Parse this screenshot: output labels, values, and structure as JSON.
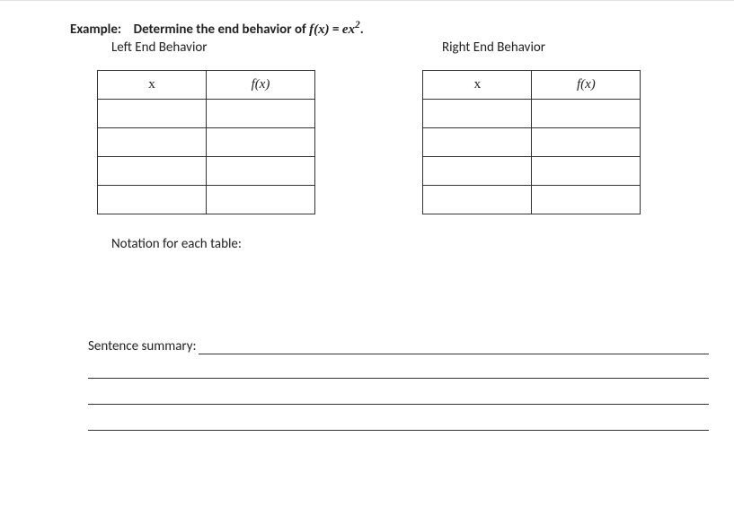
{
  "example": {
    "label": "Example:",
    "prompt_prefix": "Determine the end behavior of ",
    "fn_lhs": "f(x)",
    "equals": " = ",
    "fn_rhs_base": "ex",
    "fn_rhs_exp": "2",
    "period": "."
  },
  "headings": {
    "left": "Left End Behavior",
    "right": "Right End Behavior"
  },
  "table": {
    "col_x": "x",
    "col_fx": "f(x)",
    "blank": ""
  },
  "notation": "Notation for each table:",
  "summary_label": "Sentence summary:"
}
